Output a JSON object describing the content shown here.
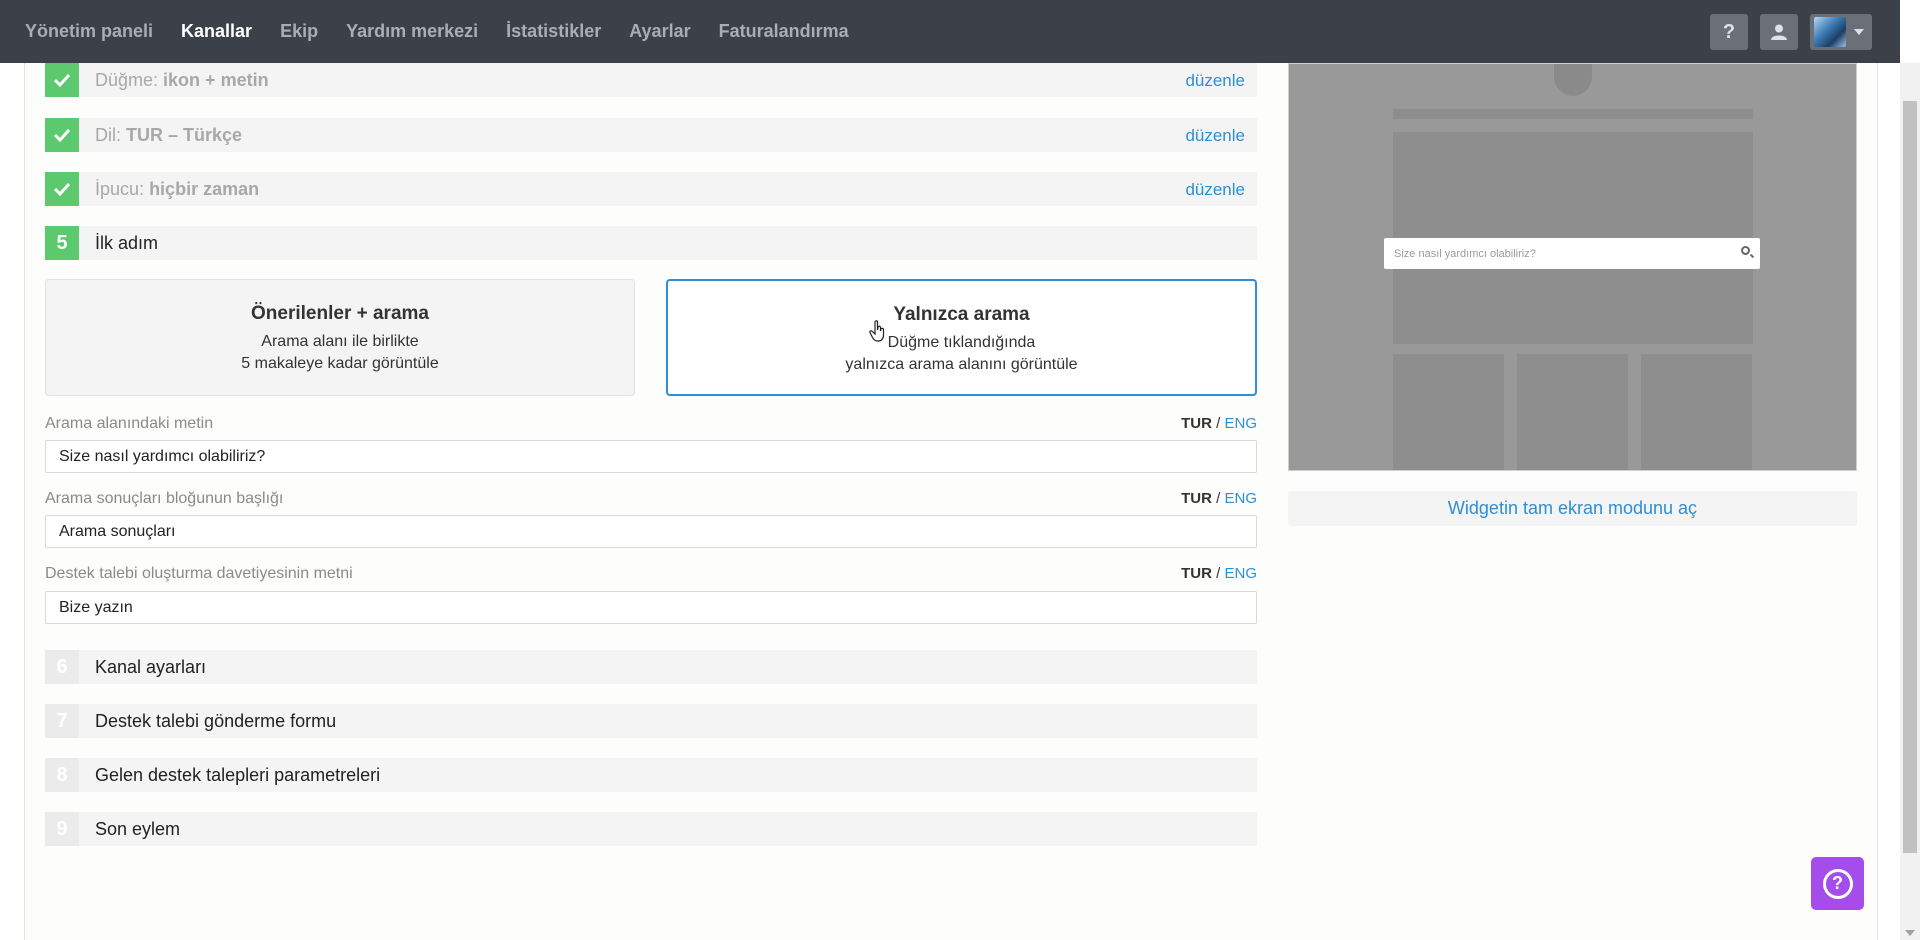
{
  "nav": {
    "items": [
      "Yönetim paneli",
      "Kanallar",
      "Ekip",
      "Yardım merkezi",
      "İstatistikler",
      "Ayarlar",
      "Faturalandırma"
    ],
    "help_glyph": "?",
    "user_icon": "user-icon"
  },
  "steps_done": [
    {
      "label": "Düğme:",
      "value": "ikon + metin",
      "edit": "düzenle"
    },
    {
      "label": "Dil:",
      "value": "TUR – Türkçe",
      "edit": "düzenle"
    },
    {
      "label": "İpucu:",
      "value": "hiçbir zaman",
      "edit": "düzenle"
    }
  ],
  "step5": {
    "number": "5",
    "title": "İlk adım"
  },
  "options": {
    "a": {
      "title": "Önerilenler + arama",
      "line1": "Arama alanı ile birlikte",
      "line2": "5 makaleye kadar görüntüle"
    },
    "b": {
      "title": "Yalnızca arama",
      "line1": "Düğme tıklandığında",
      "line2": "yalnızca arama alanını görüntüle"
    }
  },
  "fields": [
    {
      "label": "Arama alanındaki metin",
      "value": "Size nasıl yardımcı olabiliriz?"
    },
    {
      "label": "Arama sonuçları bloğunun başlığı",
      "value": "Arama sonuçları"
    },
    {
      "label": "Destek talebi oluşturma davetiyesinin metni",
      "value": "Bize yazın"
    }
  ],
  "lang": {
    "tur": "TUR",
    "sep": " / ",
    "eng": "ENG"
  },
  "steps_pending": [
    {
      "number": "6",
      "title": "Kanal ayarları"
    },
    {
      "number": "7",
      "title": "Destek talebi gönderme formu"
    },
    {
      "number": "8",
      "title": "Gelen destek talepleri parametreleri"
    },
    {
      "number": "9",
      "title": "Son eylem"
    }
  ],
  "preview": {
    "search_placeholder": "Size nasıl yardımcı olabiliriz?",
    "fullscreen_label": "Widgetin tam ekran modunu aç"
  },
  "colors": {
    "accent": "#2d8fd5",
    "success": "#5cc96e",
    "topbar": "#3c4048",
    "help_fab": "#a44dea"
  }
}
